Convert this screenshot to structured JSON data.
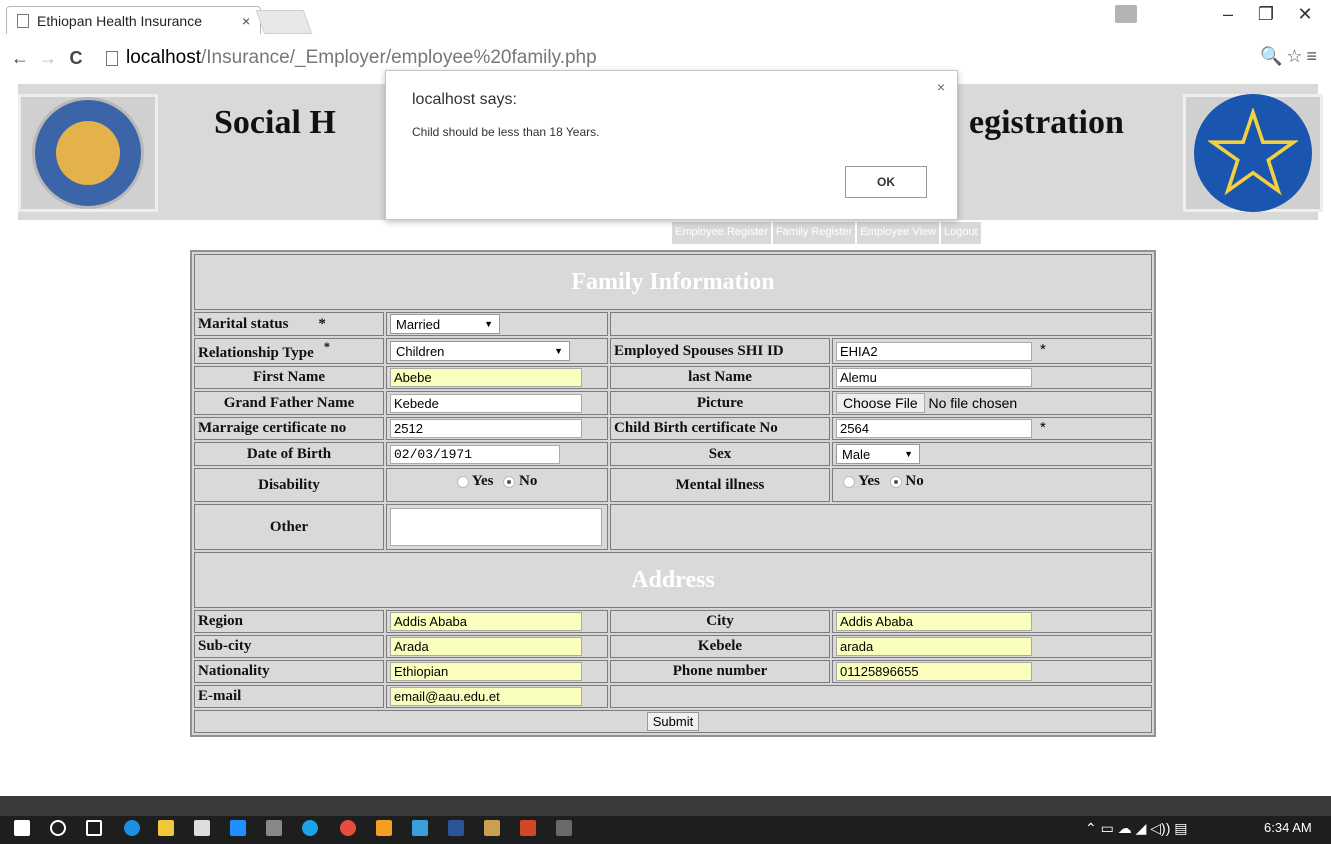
{
  "browser": {
    "tab_title": "Ethiopan Health Insurance",
    "tab_close": "×",
    "url_host": "localhost",
    "url_path": "/Insurance/_Employer/employee%20family.php",
    "nav": {
      "back": "←",
      "forward": "→",
      "reload": "C"
    },
    "right_icons": "🔍☆≡",
    "window": {
      "minimize": "–",
      "restore": "❐",
      "close": "✕"
    }
  },
  "banner": {
    "title_left": "Social H",
    "title_right": "egistration"
  },
  "menu": [
    "Employee Register",
    "Family Register",
    "Employee View",
    "Logout"
  ],
  "form": {
    "section_family": "Family Information",
    "marital_status": {
      "label": "Marital status",
      "required": "*",
      "value": "Married"
    },
    "relationship_type": {
      "label": "Relationship Type",
      "required": "*",
      "value": "Children"
    },
    "employed_spouse_id": {
      "label": "Employed Spouses SHI ID",
      "value": "EHIA2",
      "required": "*"
    },
    "first_name": {
      "label": "First Name",
      "value": "Abebe"
    },
    "last_name": {
      "label": "last Name",
      "value": "Alemu"
    },
    "grand_father_name": {
      "label": "Grand Father Name",
      "value": "Kebede"
    },
    "picture": {
      "label": "Picture",
      "button": "Choose File",
      "status": "No file chosen"
    },
    "marriage_cert": {
      "label": "Marraige certificate no",
      "value": "2512"
    },
    "child_birth_cert": {
      "label": "Child Birth certificate No",
      "value": "2564",
      "required": "*"
    },
    "date_of_birth": {
      "label": "Date of Birth",
      "value": "02/03/1971"
    },
    "sex": {
      "label": "Sex",
      "value": "Male"
    },
    "disability": {
      "label": "Disability",
      "yes": "Yes",
      "no": "No",
      "selected": "No"
    },
    "mental_illness": {
      "label": "Mental illness",
      "yes": "Yes",
      "no": "No",
      "selected": "No"
    },
    "other": {
      "label": "Other",
      "value": ""
    },
    "section_address": "Address",
    "region": {
      "label": "Region",
      "value": "Addis Ababa"
    },
    "city": {
      "label": "City",
      "value": "Addis Ababa"
    },
    "sub_city": {
      "label": "Sub-city",
      "value": "Arada"
    },
    "kebele": {
      "label": "Kebele",
      "value": "arada"
    },
    "nationality": {
      "label": "Nationality",
      "value": "Ethiopian"
    },
    "phone": {
      "label": "Phone number",
      "value": "01125896655"
    },
    "email": {
      "label": "E-mail",
      "value": "email@aau.edu.et"
    },
    "submit": "Submit"
  },
  "dialog": {
    "title": "localhost says:",
    "message": "Child should be less than 18 Years.",
    "ok": "OK",
    "close": "×"
  },
  "taskbar": {
    "time": "6:34 AM"
  },
  "colors": {
    "banner_gray": "#d9d9d9",
    "autofill_yellow": "#faffbd",
    "taskbar": "#1e1e1e"
  }
}
